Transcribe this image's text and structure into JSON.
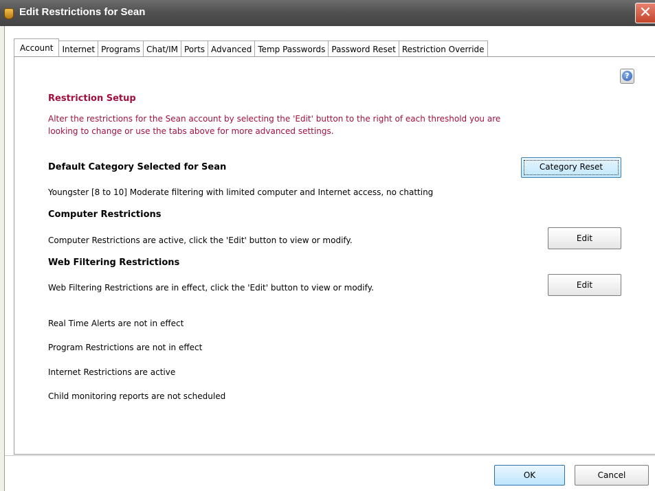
{
  "window": {
    "title": "Edit Restrictions for Sean",
    "close_glyph": "✕"
  },
  "tabs": [
    "Account",
    "Internet",
    "Programs",
    "Chat/IM",
    "Ports",
    "Advanced",
    "Temp Passwords",
    "Password Reset",
    "Restriction Override"
  ],
  "help_glyph": "?",
  "setup": {
    "heading": "Restriction Setup",
    "line1": "Alter the restrictions for the Sean account by selecting the 'Edit' button to the right of each threshold you are",
    "line2": "looking to change or use the tabs above for more advanced settings."
  },
  "default_category": {
    "heading": "Default Category Selected for Sean",
    "description": "Youngster [8 to 10] Moderate filtering with limited computer and Internet access, no chatting",
    "reset_button": "Category Reset"
  },
  "computer": {
    "heading": "Computer Restrictions",
    "status": "Computer Restrictions are active, click the 'Edit' button to view or modify.",
    "edit_button": "Edit"
  },
  "web": {
    "heading": "Web Filtering Restrictions",
    "status": "Web Filtering Restrictions are in effect, click the 'Edit' button to view or modify.",
    "edit_button": "Edit"
  },
  "statuses": {
    "alerts": "Real Time Alerts are not in effect",
    "programs": "Program Restrictions are not in effect",
    "internet": "Internet Restrictions are active",
    "reports": "Child monitoring reports are not scheduled"
  },
  "footer": {
    "ok": "OK",
    "cancel": "Cancel"
  }
}
